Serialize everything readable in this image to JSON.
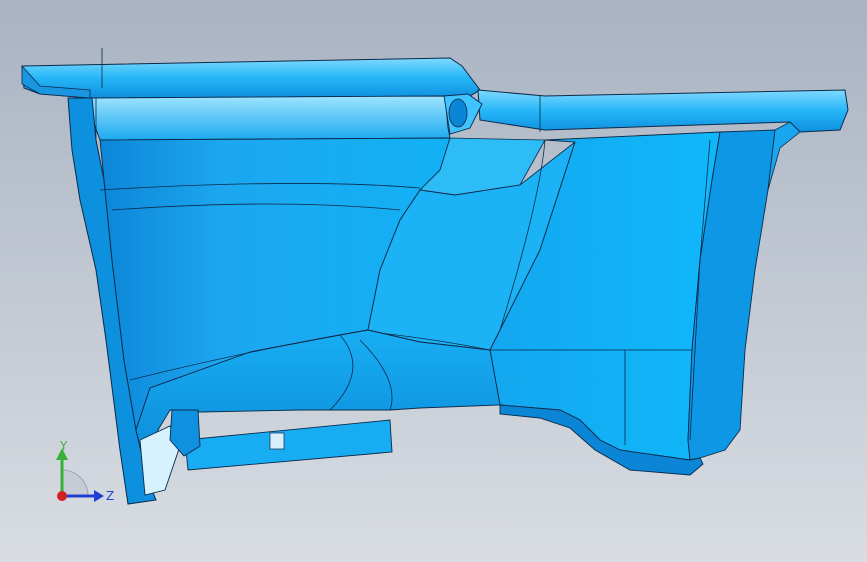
{
  "viewport": {
    "background_top": "#a9b3c2",
    "background_bottom": "#d9dde3"
  },
  "model": {
    "body_color": "#12b1f5",
    "highlight_color": "#6fd2ff",
    "shade_color": "#0a7fd0",
    "edge_color": "#0b2a4a"
  },
  "triad": {
    "y_label": "Y",
    "z_label": "Z",
    "y_color": "#3ab03a",
    "z_color": "#1f3fd6",
    "x_color": "#d61f1f"
  }
}
